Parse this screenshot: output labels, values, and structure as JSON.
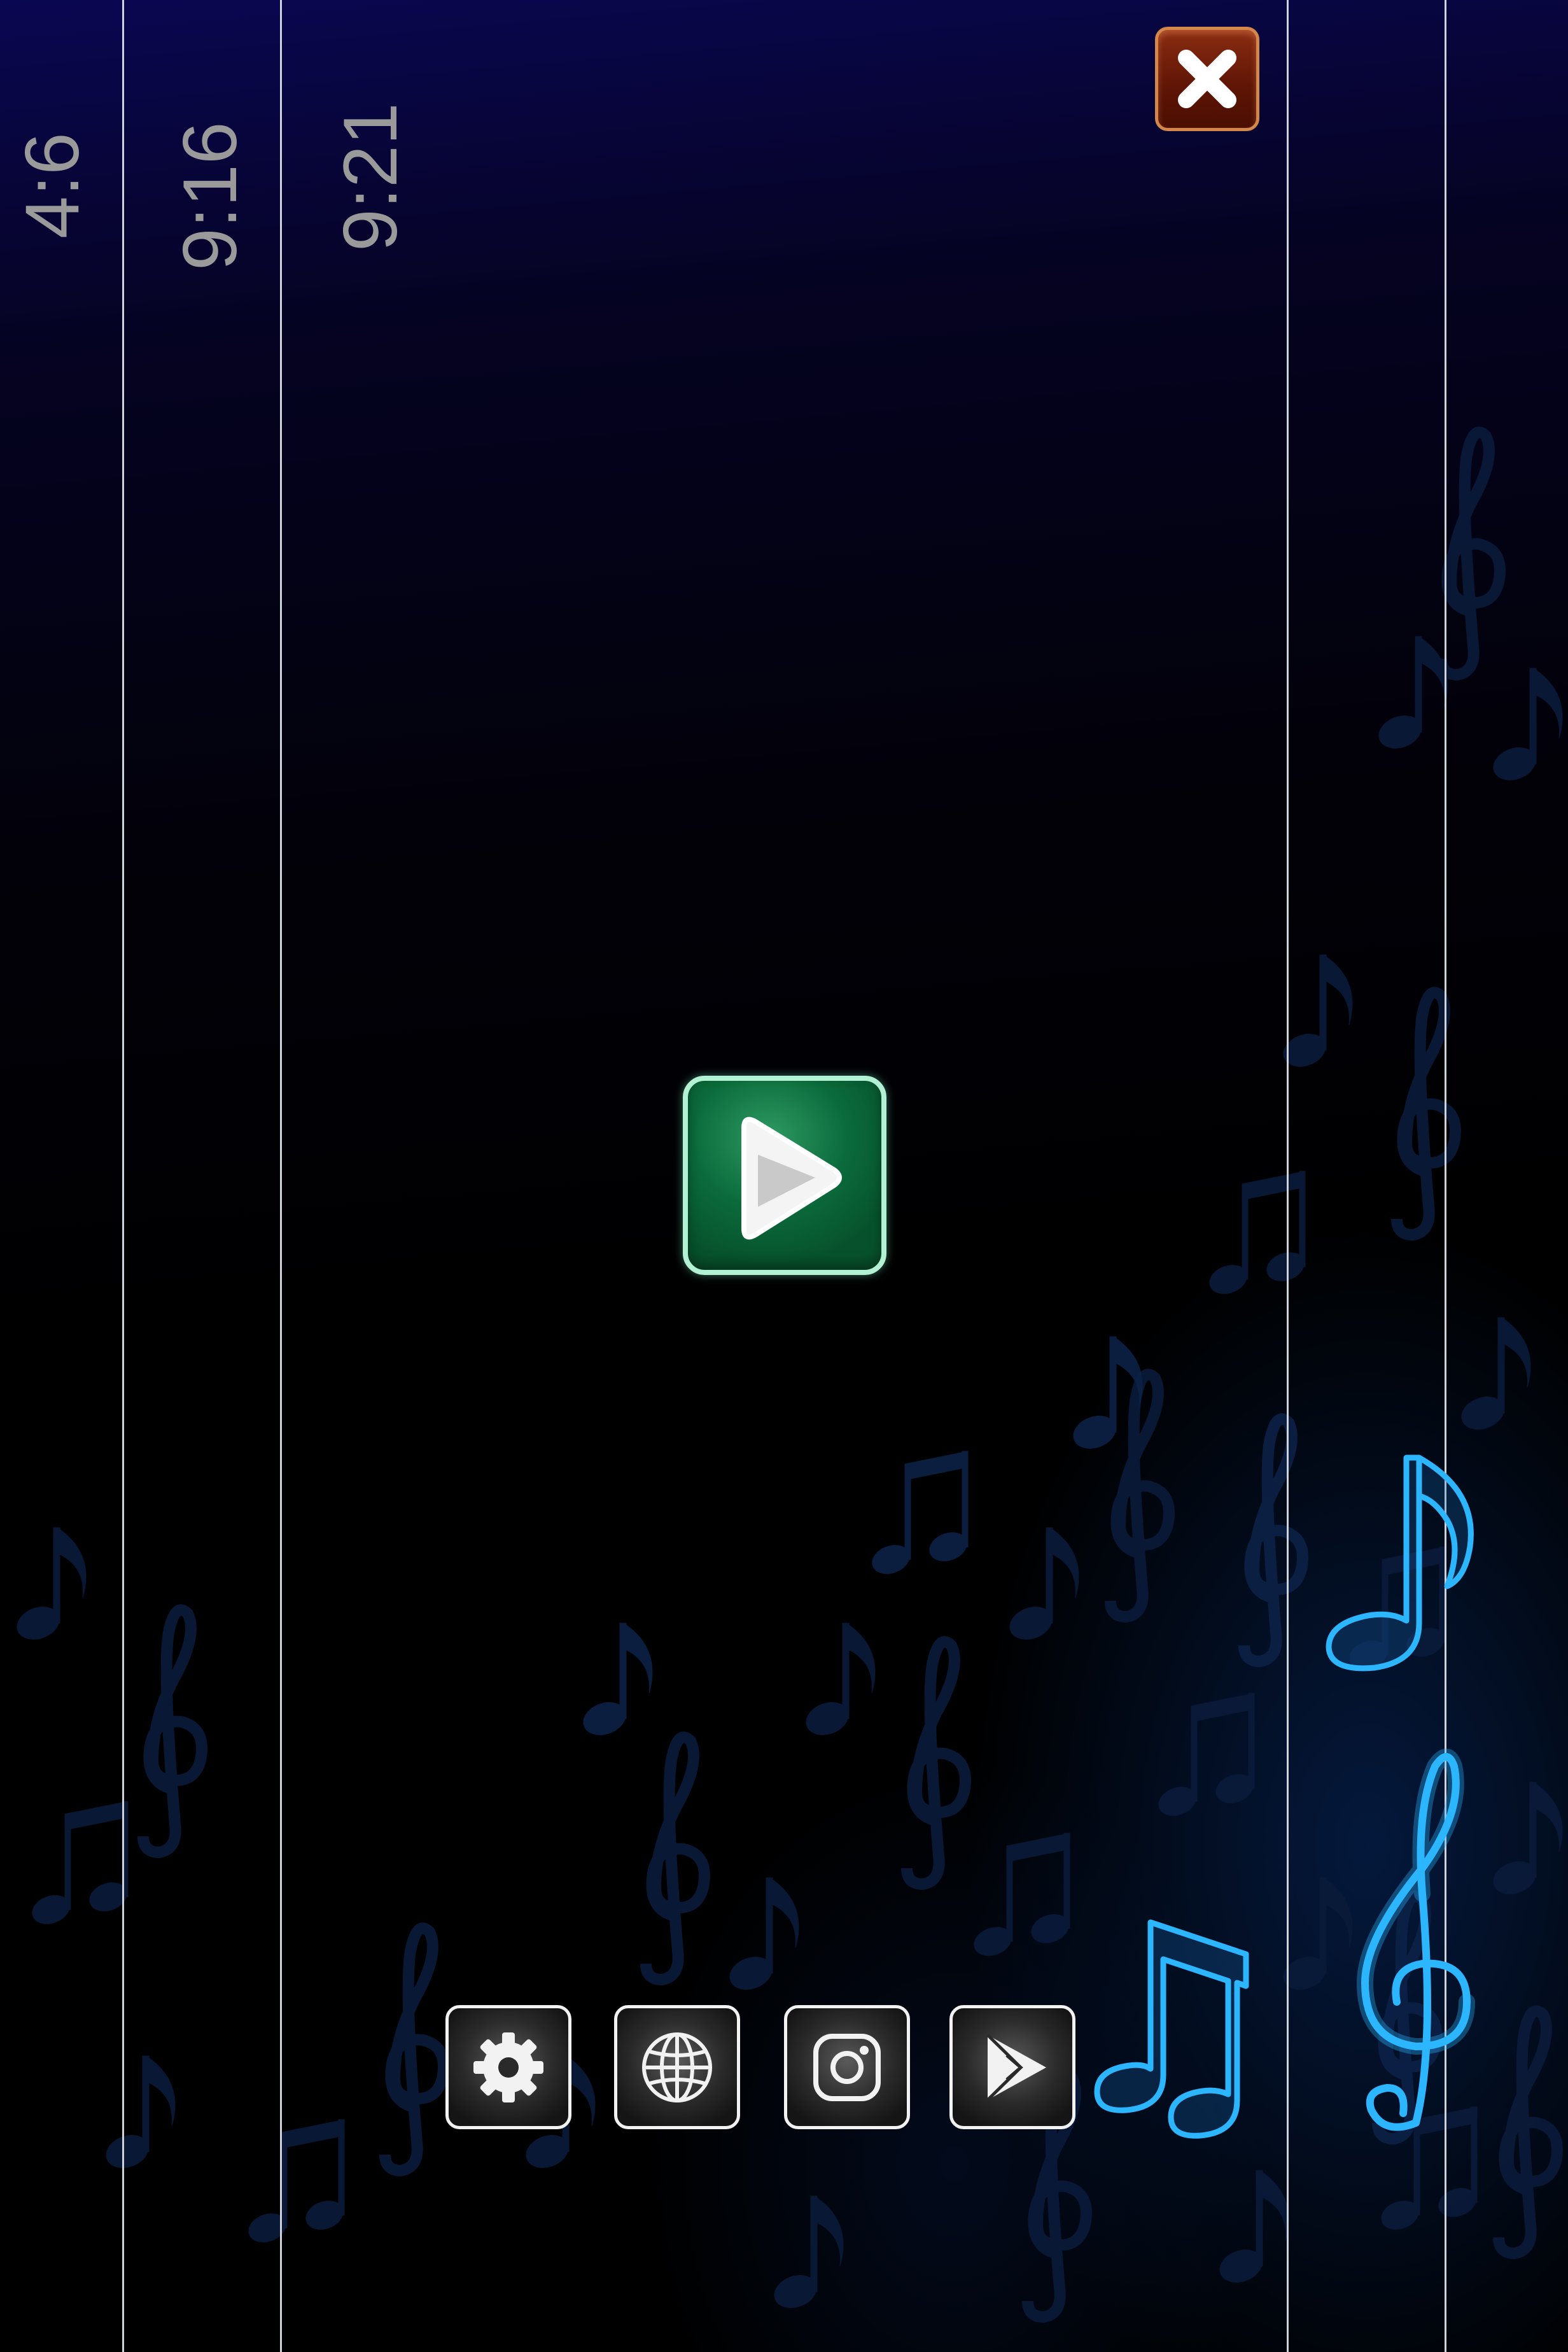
{
  "aspect_ratio_guides": [
    "4:6",
    "9:16",
    "9:21"
  ],
  "buttons": {
    "close_icon": "close-icon",
    "play_icon": "play-icon",
    "bottom_toolbar": [
      {
        "icon": "gear-icon"
      },
      {
        "icon": "globe-icon"
      },
      {
        "icon": "instagram-icon"
      },
      {
        "icon": "play-store-icon"
      }
    ]
  },
  "decorations": {
    "neon_color": "#28b4ff",
    "icons": [
      "eighth-note-icon",
      "beamed-notes-icon",
      "treble-clef-icon",
      "music-notes-pattern"
    ]
  },
  "colors": {
    "play_button": "#0b6b3c",
    "close_button": "#6a1a06",
    "top_gradient": "#0a0752",
    "background": "#000000"
  }
}
